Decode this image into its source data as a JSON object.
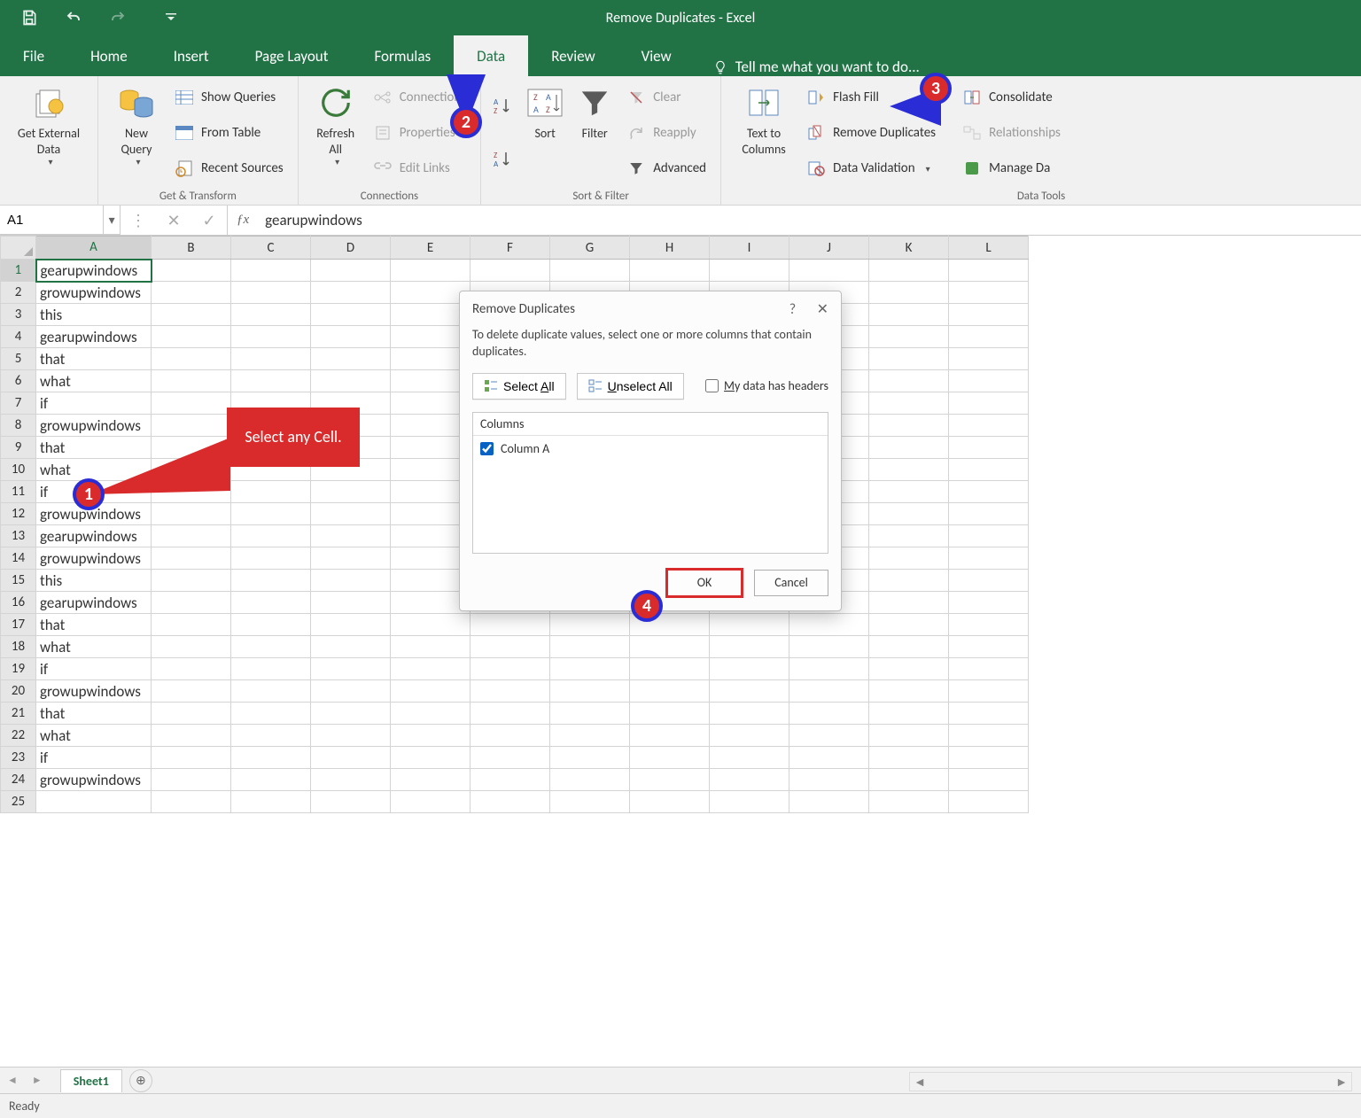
{
  "app": {
    "title": "Remove Duplicates - Excel"
  },
  "qat": {
    "save": "save",
    "undo": "undo",
    "redo": "redo"
  },
  "tabs": {
    "file": "File",
    "home": "Home",
    "insert": "Insert",
    "pageLayout": "Page Layout",
    "formulas": "Formulas",
    "data": "Data",
    "review": "Review",
    "view": "View",
    "tellme": "Tell me what you want to do..."
  },
  "ribbon": {
    "getExternal": "Get External\nData",
    "newQuery": "New\nQuery",
    "showQueries": "Show Queries",
    "fromTable": "From Table",
    "recentSources": "Recent Sources",
    "grpGetTransform": "Get & Transform",
    "refreshAll": "Refresh\nAll",
    "connections": "Connections",
    "properties": "Properties",
    "editLinks": "Edit Links",
    "grpConnections": "Connections",
    "sort": "Sort",
    "filter": "Filter",
    "clear": "Clear",
    "reapply": "Reapply",
    "advanced": "Advanced",
    "grpSortFilter": "Sort & Filter",
    "textToColumns": "Text to\nColumns",
    "flashFill": "Flash Fill",
    "removeDuplicates": "Remove Duplicates",
    "dataValidation": "Data Validation",
    "consolidate": "Consolidate",
    "relationships": "Relationships",
    "manageData": "Manage Da",
    "grpDataTools": "Data Tools"
  },
  "namebox": "A1",
  "formula": "gearupwindows",
  "columns": [
    "A",
    "B",
    "C",
    "D",
    "E",
    "F",
    "G",
    "H",
    "I",
    "J",
    "K",
    "L"
  ],
  "rows": [
    "gearupwindows",
    "growupwindows",
    "this",
    "gearupwindows",
    "that",
    "what",
    "if",
    "growupwindows",
    "that",
    "what",
    "if",
    "growupwindows",
    "gearupwindows",
    "growupwindows",
    "this",
    "gearupwindows",
    "that",
    "what",
    "if",
    "growupwindows",
    "that",
    "what",
    "if",
    "growupwindows",
    ""
  ],
  "dialog": {
    "title": "Remove Duplicates",
    "desc": "To delete duplicate values, select one or more columns that contain duplicates.",
    "selectAll": "Select All",
    "unselectAll": "Unselect All",
    "myDataHeaders": "My data has headers",
    "columnsHdr": "Columns",
    "columnA": "Column A",
    "ok": "OK",
    "cancel": "Cancel"
  },
  "callout": "Select any Cell.",
  "sheet": {
    "name": "Sheet1"
  },
  "status": "Ready"
}
